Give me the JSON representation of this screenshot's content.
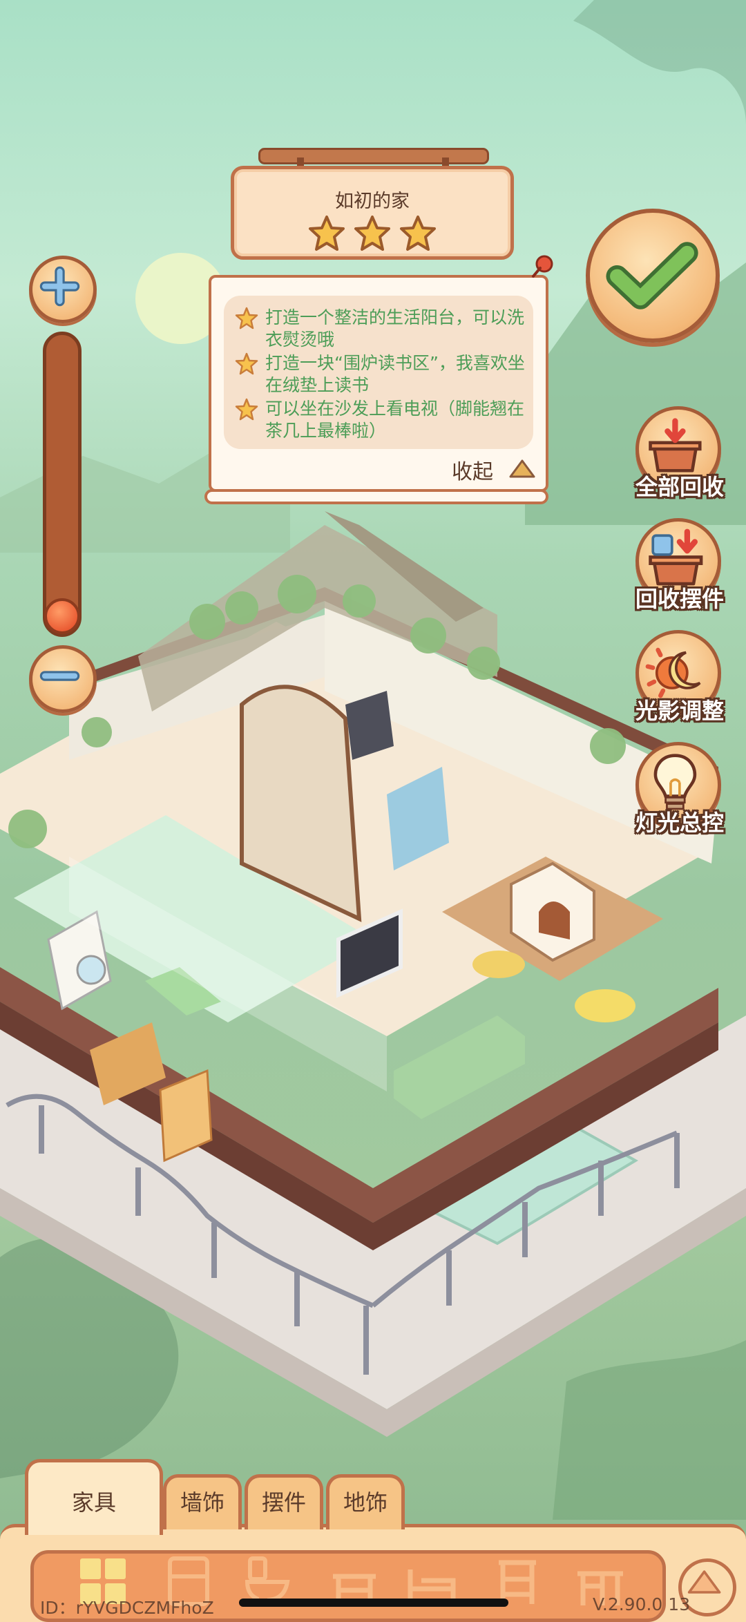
{
  "sign": {
    "title": "如初的家",
    "stars": 3
  },
  "tasks": {
    "items": [
      "打造一个整洁的生活阳台，可以洗衣熨烫哦",
      "打造一块“围炉读书区”，我喜欢坐在绒垫上读书",
      "可以坐在沙发上看电视（脚能翘在茶几上最棒啦）"
    ],
    "collapse_label": "收起"
  },
  "zoom": {
    "level": 0.03,
    "zoom_in_icon": "plus-icon",
    "zoom_out_icon": "minus-icon"
  },
  "tools": [
    {
      "label": "全部回收",
      "icon": "recycle-box-icon"
    },
    {
      "label": "回收摆件",
      "icon": "recycle-ornament-icon"
    },
    {
      "label": "光影调整",
      "icon": "sun-moon-icon"
    },
    {
      "label": "灯光总控",
      "icon": "lightbulb-icon"
    }
  ],
  "tabs": [
    {
      "label": "家具",
      "active": true
    },
    {
      "label": "墙饰",
      "active": false
    },
    {
      "label": "摆件",
      "active": false
    },
    {
      "label": "地饰",
      "active": false
    }
  ],
  "categories": [
    {
      "icon": "all-grid-icon",
      "selected": true
    },
    {
      "icon": "cabinet-icon"
    },
    {
      "icon": "toilet-icon"
    },
    {
      "icon": "table-icon"
    },
    {
      "icon": "bed-icon"
    },
    {
      "icon": "shelf-icon"
    },
    {
      "icon": "desk-icon"
    }
  ],
  "footer": {
    "id": "ID：rYVGDCZMFhoZ",
    "version": "V.2.90.0 13"
  },
  "colors": {
    "accent_wood": "#c0714a",
    "panel_cream": "#fbdcae",
    "task_text_green": "#4c9d57",
    "check_green": "#5aa04a"
  }
}
